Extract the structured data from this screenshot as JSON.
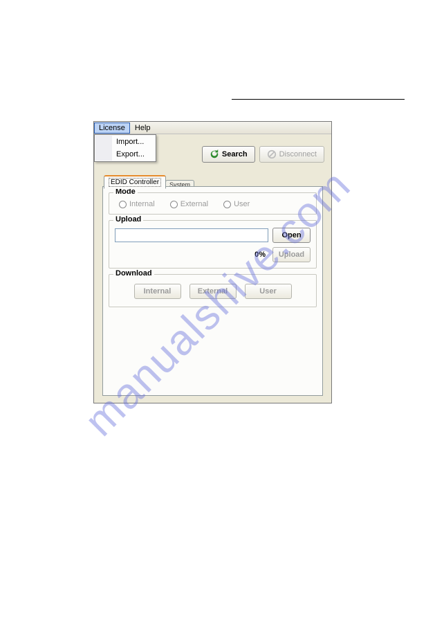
{
  "watermark": "manualshive.com",
  "menubar": {
    "license": "License",
    "help": "Help"
  },
  "license_menu": {
    "import": "Import...",
    "export": "Export..."
  },
  "toolbar": {
    "search": "Search",
    "disconnect": "Disconnect"
  },
  "tabs": {
    "edid": "EDID Controller",
    "system": "System"
  },
  "mode": {
    "legend": "Mode",
    "internal": "Internal",
    "external": "External",
    "user": "User"
  },
  "upload": {
    "legend": "Upload",
    "file_value": "",
    "open": "Open",
    "progress": "0%",
    "upload": "Upload"
  },
  "download": {
    "legend": "Download",
    "internal": "Internal",
    "external": "External",
    "user": "User"
  }
}
